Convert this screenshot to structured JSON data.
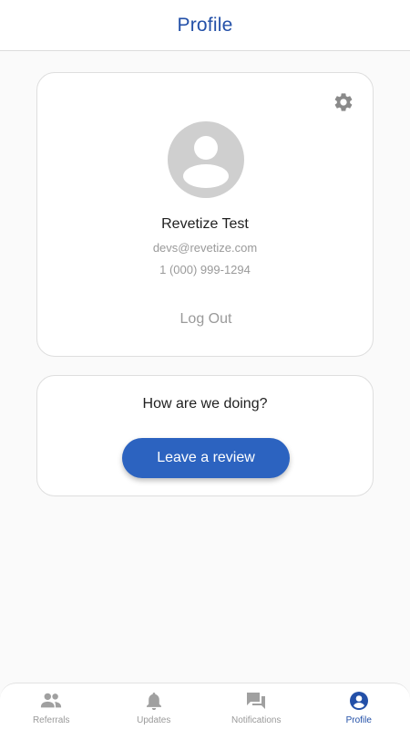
{
  "header": {
    "title": "Profile"
  },
  "profile": {
    "settings_icon": "gear-icon",
    "avatar_icon": "account-circle-icon",
    "name": "Revetize Test",
    "email": "devs@revetize.com",
    "phone": "1 (000) 999-1294",
    "logout_label": "Log Out"
  },
  "review": {
    "question": "How are we doing?",
    "button_label": "Leave a review"
  },
  "nav": {
    "items": [
      {
        "label": "Referrals",
        "icon": "people-icon",
        "active": false
      },
      {
        "label": "Updates",
        "icon": "bell-icon",
        "active": false
      },
      {
        "label": "Notifications",
        "icon": "chat-bubbles-icon",
        "active": false
      },
      {
        "label": "Profile",
        "icon": "account-circle-icon",
        "active": true
      }
    ]
  },
  "colors": {
    "accent": "#2350a8",
    "button": "#2c63c0",
    "muted": "#9a9a9a",
    "icon_inactive": "#a0a0a0",
    "background": "#fafafa"
  }
}
